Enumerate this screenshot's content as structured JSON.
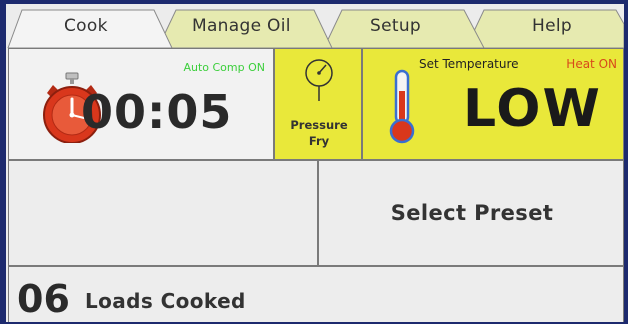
{
  "tabs": [
    {
      "label": "Cook",
      "active": true
    },
    {
      "label": "Manage Oil",
      "active": false
    },
    {
      "label": "Setup",
      "active": false
    },
    {
      "label": "Help",
      "active": false
    }
  ],
  "timer": {
    "auto_comp": "Auto Comp ON",
    "value": "00:05",
    "icon": "stopwatch-icon"
  },
  "pressure": {
    "line1": "Pressure",
    "line2": "Fry",
    "icon": "pressure-gauge-icon"
  },
  "temperature": {
    "set_label": "Set Temperature",
    "heat_status": "Heat ON",
    "value": "LOW",
    "icon": "thermometer-icon"
  },
  "preset": {
    "label": "Select Preset"
  },
  "loads": {
    "count": "06",
    "label": "Loads Cooked"
  },
  "colors": {
    "yellow_panel": "#e9e83a",
    "tab_inactive": "#e6eab0",
    "auto_comp_green": "#3ccf3c",
    "heat_on_orange": "#d84a1a",
    "stopwatch_red": "#d9371c",
    "bezel": "#1d2a6e"
  }
}
